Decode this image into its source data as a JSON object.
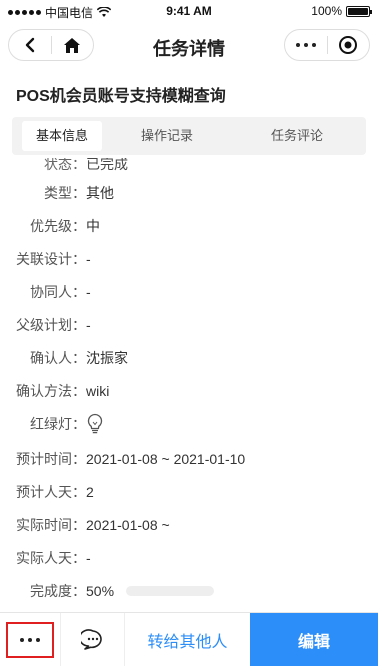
{
  "status_bar": {
    "carrier": "中国电信",
    "time": "9:41 AM",
    "battery": "100%"
  },
  "nav": {
    "title": "任务详情"
  },
  "task_title": "POS机会员账号支持模糊查询",
  "tabs": [
    {
      "label": "基本信息",
      "active": true
    },
    {
      "label": "操作记录",
      "active": false
    },
    {
      "label": "任务评论",
      "active": false
    }
  ],
  "details": {
    "clipped_label": "状态：",
    "clipped_value": "已完成",
    "type_label": "类型：",
    "type_value": "其他",
    "priority_label": "优先级：",
    "priority_value": "中",
    "design_label": "关联设计：",
    "design_value": "-",
    "collab_label": "协同人：",
    "collab_value": "-",
    "parent_label": "父级计划：",
    "parent_value": "-",
    "confirmer_label": "确认人：",
    "confirmer_value": "沈振家",
    "confirm_method_label": "确认方法：",
    "confirm_method_value": "wiki",
    "light_label": "红绿灯：",
    "planned_time_label": "预计时间：",
    "planned_time_value": "2021-01-08 ~ 2021-01-10",
    "planned_days_label": "预计人天：",
    "planned_days_value": "2",
    "actual_time_label": "实际时间：",
    "actual_time_value": "2021-01-08 ~",
    "actual_days_label": "实际人天：",
    "actual_days_value": "-",
    "completion_label": "完成度：",
    "completion_value": "50%",
    "completion_fraction": 0.5
  },
  "bottom": {
    "transfer_label": "转给其他人",
    "edit_label": "编辑"
  },
  "colors": {
    "accent": "#2c8ef8",
    "progress": "#f7941d",
    "highlight": "#e02020"
  }
}
